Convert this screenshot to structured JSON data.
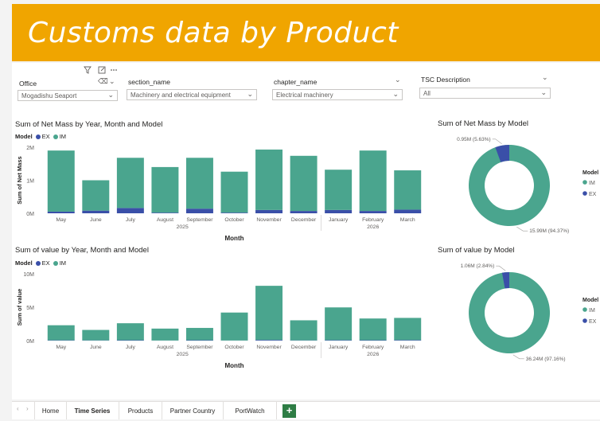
{
  "banner": {
    "title": "Customs data by Product"
  },
  "header_icons": {
    "filter": "filter-icon",
    "focus": "focus-mode-icon",
    "more": "more-options-icon"
  },
  "slicers": [
    {
      "label": "Office",
      "value": "Mogadishu Seaport"
    },
    {
      "label": "section_name",
      "value": "Machinery and electrical equipment"
    },
    {
      "label": "chapter_name",
      "value": "Electrical machinery"
    },
    {
      "label": "TSC Description",
      "value": "All"
    }
  ],
  "colors": {
    "IM": "#4aa58e",
    "EX": "#3a4fa8",
    "banner": "#f0a500"
  },
  "charts_text": {
    "bar1_title": "Sum of Net Mass by Year, Month and Model",
    "bar1_ylabel": "Sum of Net Mass",
    "bar2_title": "Sum of value by Year, Month and Model",
    "bar2_ylabel": "Sum of value",
    "xlabel": "Month",
    "legend_title": "Model",
    "legend_ex": "EX",
    "legend_im": "IM",
    "donut1_title": "Sum of Net Mass by Model",
    "donut2_title": "Sum of value by Model"
  },
  "chart_data": [
    {
      "type": "bar",
      "title": "Sum of Net Mass by Year, Month and Model",
      "xlabel": "Month",
      "ylabel": "Sum of Net Mass",
      "ylim": [
        0,
        2000000
      ],
      "yticks": [
        "0M",
        "1M",
        "2M"
      ],
      "categories": [
        "May",
        "June",
        "July",
        "August",
        "September",
        "October",
        "November",
        "December",
        "January",
        "February",
        "March"
      ],
      "year_labels": [
        {
          "label": "2025",
          "span": [
            0,
            7
          ]
        },
        {
          "label": "2026",
          "span": [
            8,
            10
          ]
        }
      ],
      "stacked": true,
      "series": [
        {
          "name": "EX",
          "values": [
            50000,
            80000,
            160000,
            20000,
            140000,
            20000,
            100000,
            70000,
            100000,
            70000,
            110000
          ]
        },
        {
          "name": "IM",
          "values": [
            1850000,
            920000,
            1520000,
            1380000,
            1540000,
            1240000,
            1830000,
            1670000,
            1220000,
            1830000,
            1190000
          ]
        }
      ]
    },
    {
      "type": "pie",
      "title": "Sum of Net Mass by Model",
      "donut": true,
      "slices": [
        {
          "name": "IM",
          "value": 15.99,
          "label": "15.99M (94.37%)"
        },
        {
          "name": "EX",
          "value": 0.95,
          "label": "0.95M (5.63%)"
        }
      ],
      "legend_title": "Model",
      "legend": [
        "IM",
        "EX"
      ]
    },
    {
      "type": "bar",
      "title": "Sum of value by Year, Month and Model",
      "xlabel": "Month",
      "ylabel": "Sum of value",
      "ylim": [
        0,
        10000000
      ],
      "yticks": [
        "0M",
        "5M",
        "10M"
      ],
      "categories": [
        "May",
        "June",
        "July",
        "August",
        "September",
        "October",
        "November",
        "December",
        "January",
        "February",
        "March"
      ],
      "year_labels": [
        {
          "label": "2025",
          "span": [
            0,
            7
          ]
        },
        {
          "label": "2026",
          "span": [
            8,
            10
          ]
        }
      ],
      "stacked": true,
      "series": [
        {
          "name": "EX",
          "values": [
            50000,
            40000,
            60000,
            20000,
            60000,
            20000,
            100000,
            40000,
            70000,
            60000,
            80000
          ]
        },
        {
          "name": "IM",
          "values": [
            2250000,
            1560000,
            2540000,
            1780000,
            1840000,
            4180000,
            8100000,
            3000000,
            4900000,
            3250000,
            3320000
          ]
        }
      ]
    },
    {
      "type": "pie",
      "title": "Sum of value by Model",
      "donut": true,
      "slices": [
        {
          "name": "IM",
          "value": 36.24,
          "label": "36.24M (97.16%)"
        },
        {
          "name": "EX",
          "value": 1.06,
          "label": "1.06M (2.84%)"
        }
      ],
      "legend_title": "Model",
      "legend": [
        "IM",
        "EX"
      ]
    }
  ],
  "tabs": [
    {
      "label": "Home",
      "active": false
    },
    {
      "label": "Time Series",
      "active": true
    },
    {
      "label": "Products",
      "active": false
    },
    {
      "label": "Partner Country",
      "active": false
    },
    {
      "label": "PortWatch",
      "active": false
    }
  ],
  "add_tab": "+"
}
